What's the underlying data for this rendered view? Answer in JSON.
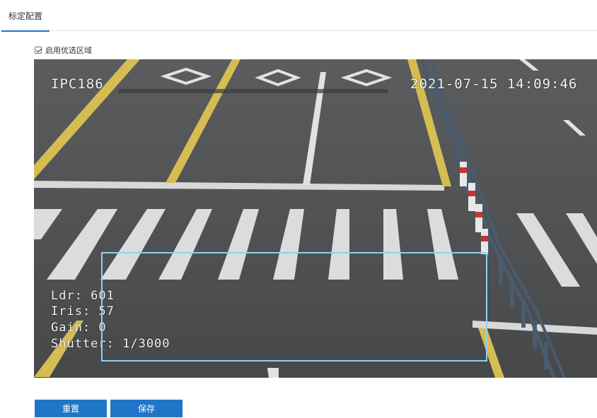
{
  "tabs": [
    {
      "label": "标定配置",
      "active": true
    }
  ],
  "enable_region": {
    "label": "启用优选区域",
    "checked": true
  },
  "video": {
    "camera_name": "IPC186",
    "timestamp": "2021-07-15 14:09:46",
    "stats": {
      "ldr": "Ldr: 601",
      "iris": "Iris: 57",
      "gain": "Gain: 0",
      "shutter": "Shutter: 1/3000"
    },
    "roi_color": "#8ecff5"
  },
  "buttons": {
    "reset": "重置",
    "save": "保存"
  },
  "colors": {
    "accent": "#1f76c9"
  }
}
